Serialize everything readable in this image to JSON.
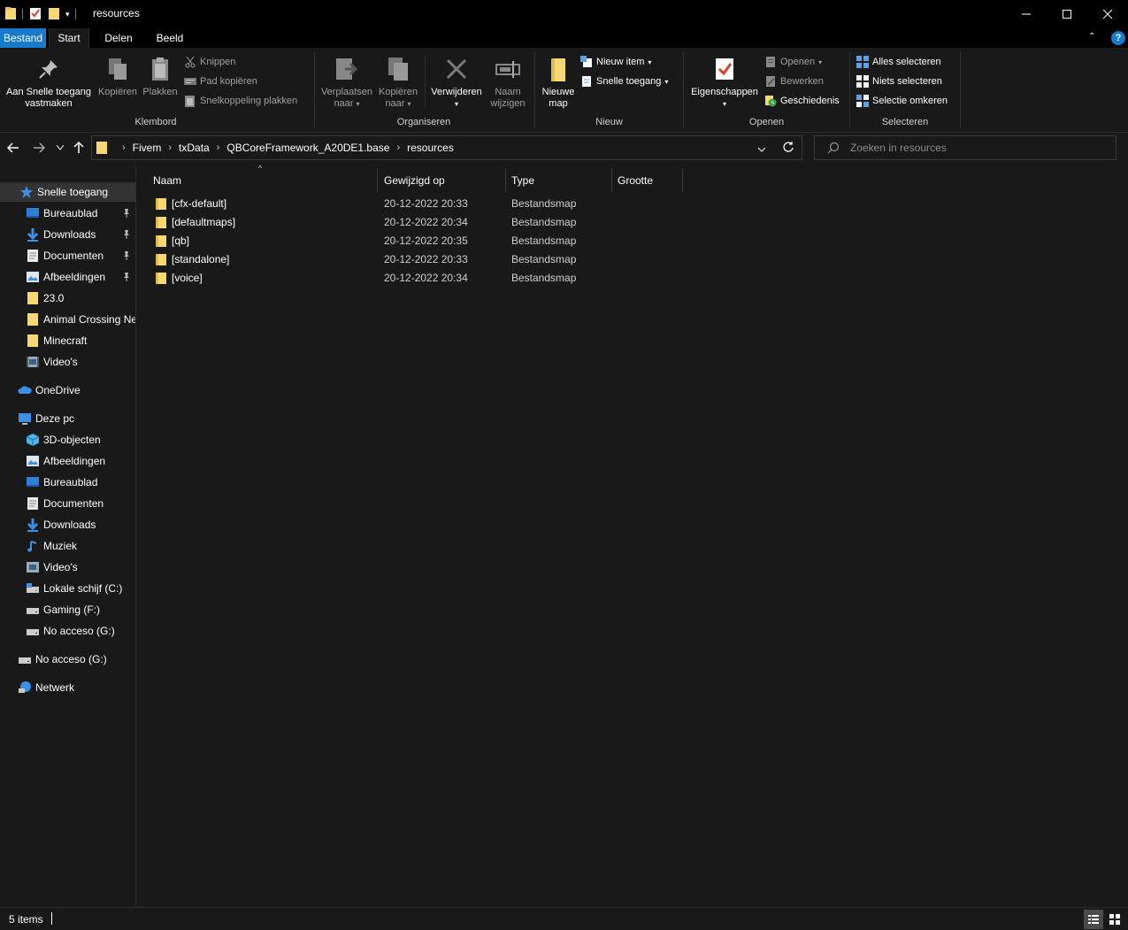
{
  "window": {
    "title": "resources",
    "quick_access_toolbar": [
      "folder-icon",
      "properties-icon",
      "new-folder-icon",
      "customize-dropdown"
    ]
  },
  "tabs": [
    {
      "label": "Bestand"
    },
    {
      "label": "Start"
    },
    {
      "label": "Delen"
    },
    {
      "label": "Beeld"
    }
  ],
  "ribbon": {
    "klembord": {
      "label": "Klembord",
      "pin": "Aan Snelle toegang",
      "pin2": "vastmaken",
      "copy": "Kopiëren",
      "paste": "Plakken",
      "cut": "Knippen",
      "copy_path": "Pad kopiëren",
      "paste_shortcut": "Snelkoppeling plakken"
    },
    "organiseren": {
      "label": "Organiseren",
      "move": "Verplaatsen",
      "move2": "naar",
      "copyto": "Kopiëren",
      "copyto2": "naar",
      "delete": "Verwijderen",
      "rename": "Naam",
      "rename2": "wijzigen"
    },
    "nieuw": {
      "label": "Nieuw",
      "new_folder": "Nieuwe",
      "new_folder2": "map",
      "new_item": "Nieuw item",
      "easy_access": "Snelle toegang"
    },
    "openen": {
      "label": "Openen",
      "properties": "Eigenschappen",
      "open": "Openen",
      "edit": "Bewerken",
      "history": "Geschiedenis"
    },
    "selecteren": {
      "label": "Selecteren",
      "select_all": "Alles selecteren",
      "select_none": "Niets selecteren",
      "invert": "Selectie omkeren"
    }
  },
  "address": {
    "crumbs": [
      "Fivem",
      "txData",
      "QBCoreFramework_A20DE1.base",
      "resources"
    ],
    "search_placeholder": "Zoeken in resources"
  },
  "navpane": {
    "quick_access": "Snelle toegang",
    "pinned": [
      {
        "label": "Bureaublad",
        "icon": "desktop-icon"
      },
      {
        "label": "Downloads",
        "icon": "downloads-icon"
      },
      {
        "label": "Documenten",
        "icon": "documents-icon"
      },
      {
        "label": "Afbeeldingen",
        "icon": "pictures-icon"
      }
    ],
    "recent": [
      {
        "label": "23.0",
        "icon": "folder-icon"
      },
      {
        "label": "Animal Crossing New Horizons",
        "icon": "folder-icon"
      },
      {
        "label": "Minecraft",
        "icon": "folder-icon"
      },
      {
        "label": "Video's",
        "icon": "videos-icon"
      }
    ],
    "onedrive": "OneDrive",
    "this_pc": "Deze pc",
    "pc_items": [
      {
        "label": "3D-objecten",
        "icon": "3d-objects-icon"
      },
      {
        "label": "Afbeeldingen",
        "icon": "pictures-icon"
      },
      {
        "label": "Bureaublad",
        "icon": "desktop-icon"
      },
      {
        "label": "Documenten",
        "icon": "documents-icon"
      },
      {
        "label": "Downloads",
        "icon": "downloads-icon"
      },
      {
        "label": "Muziek",
        "icon": "music-icon"
      },
      {
        "label": "Video's",
        "icon": "videos-icon"
      },
      {
        "label": "Lokale schijf (C:)",
        "icon": "drive-c-icon"
      },
      {
        "label": "Gaming (F:)",
        "icon": "drive-icon"
      },
      {
        "label": "No acceso (G:)",
        "icon": "drive-icon"
      }
    ],
    "removable": "No acceso (G:)",
    "network": "Netwerk"
  },
  "columns": {
    "name": "Naam",
    "modified": "Gewijzigd op",
    "type": "Type",
    "size": "Grootte"
  },
  "files": [
    {
      "name": "[cfx-default]",
      "modified": "20-12-2022 20:33",
      "type": "Bestandsmap"
    },
    {
      "name": "[defaultmaps]",
      "modified": "20-12-2022 20:34",
      "type": "Bestandsmap"
    },
    {
      "name": "[qb]",
      "modified": "20-12-2022 20:35",
      "type": "Bestandsmap"
    },
    {
      "name": "[standalone]",
      "modified": "20-12-2022 20:33",
      "type": "Bestandsmap"
    },
    {
      "name": "[voice]",
      "modified": "20-12-2022 20:34",
      "type": "Bestandsmap"
    }
  ],
  "status": {
    "count": "5 items"
  },
  "colors": {
    "accent": "#1979ca",
    "folder": "#f8d775",
    "background": "#191919",
    "titlebar": "#000000",
    "selected": "#333333"
  }
}
